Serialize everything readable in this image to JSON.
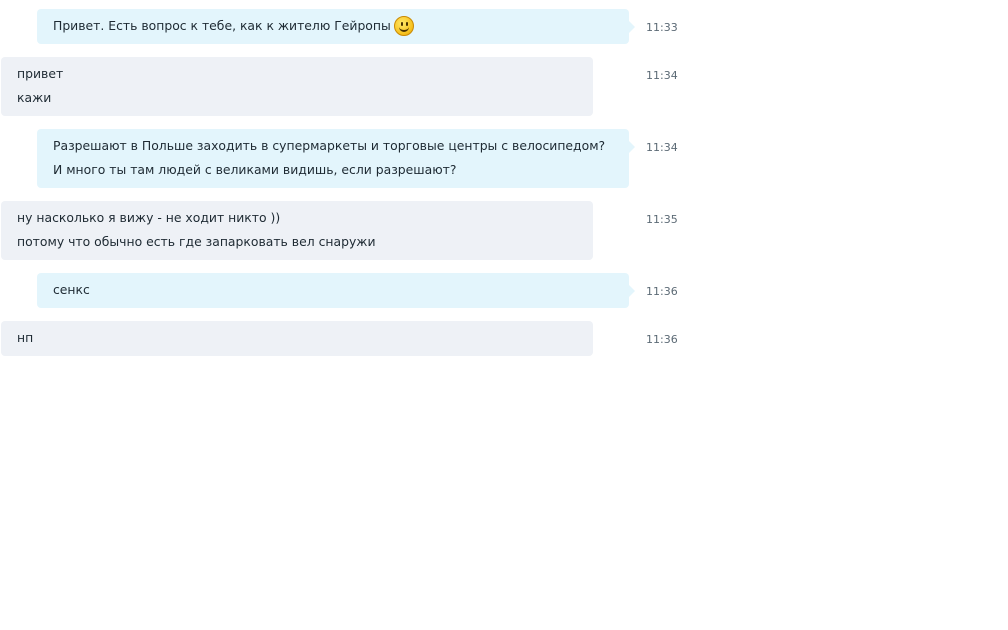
{
  "messages": [
    {
      "direction": "out",
      "lines": [
        "Привет. Есть вопрос к тебе, как к жителю Гейропы"
      ],
      "emoji": "smiley-icon",
      "time": "11:33"
    },
    {
      "direction": "in",
      "lines": [
        "привет",
        "кажи"
      ],
      "time": "11:34"
    },
    {
      "direction": "out",
      "lines": [
        "Разрешают в Польше заходить в супермаркеты и торговые центры с велосипедом?",
        "И много ты там людей с великами видишь, если разрешают?"
      ],
      "time": "11:34"
    },
    {
      "direction": "in",
      "lines": [
        "ну насколько я вижу - не ходит никто ))",
        "потому что обычно есть где запарковать вел снаружи"
      ],
      "time": "11:35"
    },
    {
      "direction": "out",
      "lines": [
        "сенкс"
      ],
      "time": "11:36"
    },
    {
      "direction": "in",
      "lines": [
        "нп"
      ],
      "time": "11:36"
    }
  ],
  "colors": {
    "outgoing_bubble": "#e3f5fc",
    "incoming_bubble": "#eef1f6",
    "timestamp": "#5c6a75"
  }
}
